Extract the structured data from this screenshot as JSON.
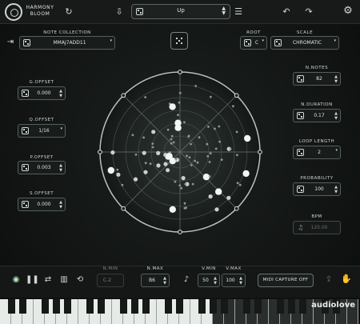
{
  "app": {
    "brand_line1": "HARMONY",
    "brand_line2": "BLOOM"
  },
  "toolbar": {
    "preset_name": "Up",
    "menu_icon": "hamburger-menu-icon",
    "undo_icon": "undo-icon",
    "redo_icon": "redo-icon",
    "settings_icon": "gear-icon",
    "refresh_icon": "refresh-icon",
    "save_icon": "save-icon"
  },
  "note_collection": {
    "label": "NOTE COLLECTION",
    "value": "MMAJ7ADD11"
  },
  "root": {
    "label": "ROOT",
    "value": "C"
  },
  "scale": {
    "label": "SCALE",
    "value": "CHROMATIC"
  },
  "left_params": [
    {
      "label": "G.OFFSET",
      "value": "0.000"
    },
    {
      "label": "Q.OFFSET",
      "value": "1/16"
    },
    {
      "label": "P.OFFSET",
      "value": "0.003"
    },
    {
      "label": "S.OFFSET",
      "value": "0.000"
    }
  ],
  "right_params": [
    {
      "label": "N.NOTES",
      "value": "82"
    },
    {
      "label": "N.DURATION",
      "value": "0.17"
    },
    {
      "label": "LOOP LENGTH",
      "value": "2"
    },
    {
      "label": "PROBABILITY",
      "value": "100"
    },
    {
      "label": "BPM",
      "value": "120.00"
    }
  ],
  "bottom": {
    "n_min": {
      "label": "N.MIN",
      "value": "C-2"
    },
    "n_max": {
      "label": "N.MAX",
      "value": "B6"
    },
    "v_min": {
      "label": "V.MIN",
      "value": "50"
    },
    "v_max": {
      "label": "V.MAX",
      "value": "100"
    },
    "midi_capture": "MIDI CAPTURE OFF"
  },
  "watermark": "audiolove",
  "colors": {
    "accent": "#dfe6e2",
    "panel": "#181c1b",
    "border": "#56605c"
  }
}
